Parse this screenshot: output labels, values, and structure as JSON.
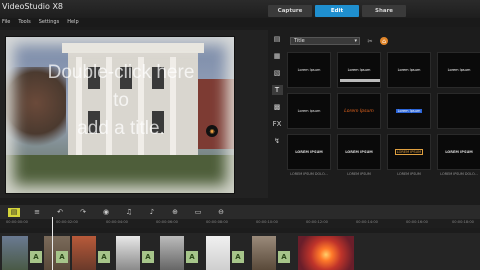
{
  "app": {
    "title": "VideoStudio X8"
  },
  "menu": [
    "File",
    "Tools",
    "Settings",
    "Help"
  ],
  "tabs": [
    {
      "label": "Capture",
      "active": false
    },
    {
      "label": "Edit",
      "active": true
    },
    {
      "label": "Share",
      "active": false
    }
  ],
  "preview": {
    "overlay_text": [
      "Double-click here",
      "to",
      "add a title."
    ],
    "progress": 0.83,
    "mode_labels": {
      "project": "Project",
      "clip": "Clip"
    }
  },
  "library": {
    "category": "Title",
    "thumbnails": [
      {
        "text": "Lorem Ipsum",
        "caption": ""
      },
      {
        "text": "Lorem Ipsum",
        "caption": ""
      },
      {
        "text": "Lorem Ipsum",
        "caption": ""
      },
      {
        "text": "Lorem Ipsum",
        "caption": ""
      },
      {
        "text": "Lorem ipsum",
        "caption": ""
      },
      {
        "text": "Lorem Ipsum",
        "caption": ""
      },
      {
        "text": "Lorem Ipsum",
        "caption": ""
      },
      {
        "text": "",
        "caption": ""
      },
      {
        "text": "LOREM IPSUM",
        "caption": "LOREM IPSUM DOLO..."
      },
      {
        "text": "LOREM IPSUM",
        "caption": "LOREM IPSUM"
      },
      {
        "text": "LOREM IPSUM",
        "caption": "LOREM IPSUM"
      },
      {
        "text": "LOREM IPSUM",
        "caption": "LOREM IPSUM DOLO..."
      }
    ]
  },
  "timeline": {
    "ticks": [
      "00:00:00:00",
      "00:00:02:00",
      "00:00:04:00",
      "00:00:06:00",
      "00:00:08:00",
      "00:00:10:00",
      "00:00:12:00",
      "00:00:14:00",
      "00:00:16:00",
      "00:00:18:00"
    ],
    "transition_label": "A"
  }
}
